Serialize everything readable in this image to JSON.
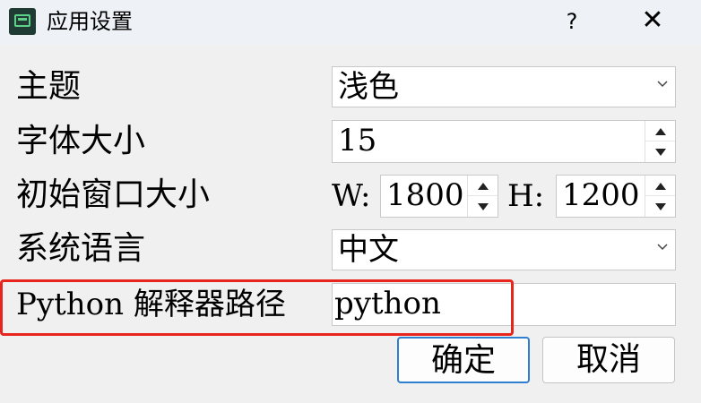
{
  "window": {
    "title": "应用设置",
    "help_label": "?",
    "close_label": "✕",
    "icon": "app-icon"
  },
  "settings": {
    "theme": {
      "label": "主题",
      "value": "浅色"
    },
    "font_size": {
      "label": "字体大小",
      "value": "15"
    },
    "window_size": {
      "label": "初始窗口大小",
      "width_label": "W:",
      "width_value": "1800",
      "height_label": "H:",
      "height_value": "1200"
    },
    "language": {
      "label": "系统语言",
      "value": "中文"
    },
    "python_path": {
      "label": "Python 解释器路径",
      "value": "python"
    }
  },
  "buttons": {
    "ok": "确定",
    "cancel": "取消"
  },
  "colors": {
    "highlight": "#e8251d",
    "primary_border": "#2f7fd0"
  }
}
